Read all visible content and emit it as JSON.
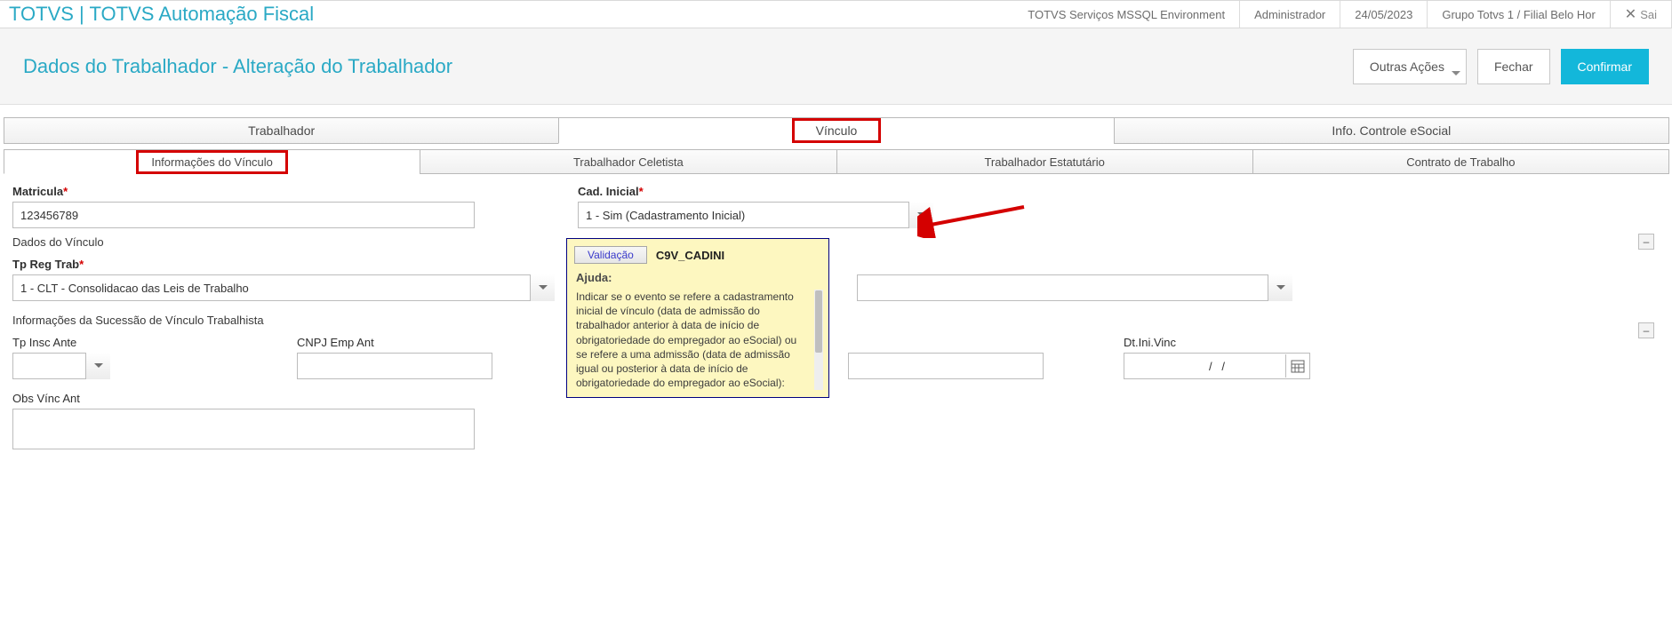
{
  "topbar": {
    "title": "TOTVS | TOTVS Automação Fiscal",
    "env": "TOTVS Serviços MSSQL Environment",
    "user": "Administrador",
    "date": "24/05/2023",
    "branch": "Grupo Totvs 1 / Filial Belo Hor",
    "exit_label": "Sai"
  },
  "pageheader": {
    "title": "Dados do Trabalhador - Alteração do Trabalhador",
    "btn_other": "Outras Ações",
    "btn_close": "Fechar",
    "btn_confirm": "Confirmar"
  },
  "tabs1": [
    {
      "label": "Trabalhador",
      "active": false
    },
    {
      "label": "Vínculo",
      "active": true,
      "highlight": true
    },
    {
      "label": "Info. Controle eSocial",
      "active": false
    }
  ],
  "tabs2": [
    {
      "label": "Informações do Vínculo",
      "active": true,
      "highlight": true
    },
    {
      "label": "Trabalhador Celetista",
      "active": false
    },
    {
      "label": "Trabalhador Estatutário",
      "active": false
    },
    {
      "label": "Contrato de Trabalho",
      "active": false
    }
  ],
  "fields": {
    "matricula": {
      "label": "Matricula",
      "value": "123456789"
    },
    "cad_inicial": {
      "label": "Cad. Inicial",
      "value": "1 - Sim (Cadastramento Inicial)"
    },
    "section_dados_vinculo": "Dados do Vínculo",
    "tp_reg_trab": {
      "label": "Tp Reg Trab",
      "value": "1 - CLT - Consolidacao das Leis de Trabalho"
    },
    "hidden_combo_value": "",
    "section_sucessao": "Informações da Sucessão de Vínculo Trabalhista",
    "tp_insc_ante": {
      "label": "Tp Insc Ante",
      "value": ""
    },
    "cnpj_emp_ant": {
      "label": "CNPJ Emp Ant",
      "value": ""
    },
    "blank_mid": {
      "value": ""
    },
    "dt_ini_vinc": {
      "label": "Dt.Ini.Vinc",
      "value": "/   /"
    },
    "obs_vinc_ant": {
      "label": "Obs Vínc Ant",
      "value": ""
    }
  },
  "help": {
    "btn": "Validação",
    "code": "C9V_CADINI",
    "ajuda_label": "Ajuda:",
    "text": "Indicar se o evento se refere a cadastramento inicial de vínculo (data de admissão do trabalhador anterior à data de início de obrigatoriedade do empregador ao eSocial) ou se refere a uma admissão (data de admissão igual ou posterior à data de início de obrigatoriedade do empregador ao eSocial):"
  }
}
